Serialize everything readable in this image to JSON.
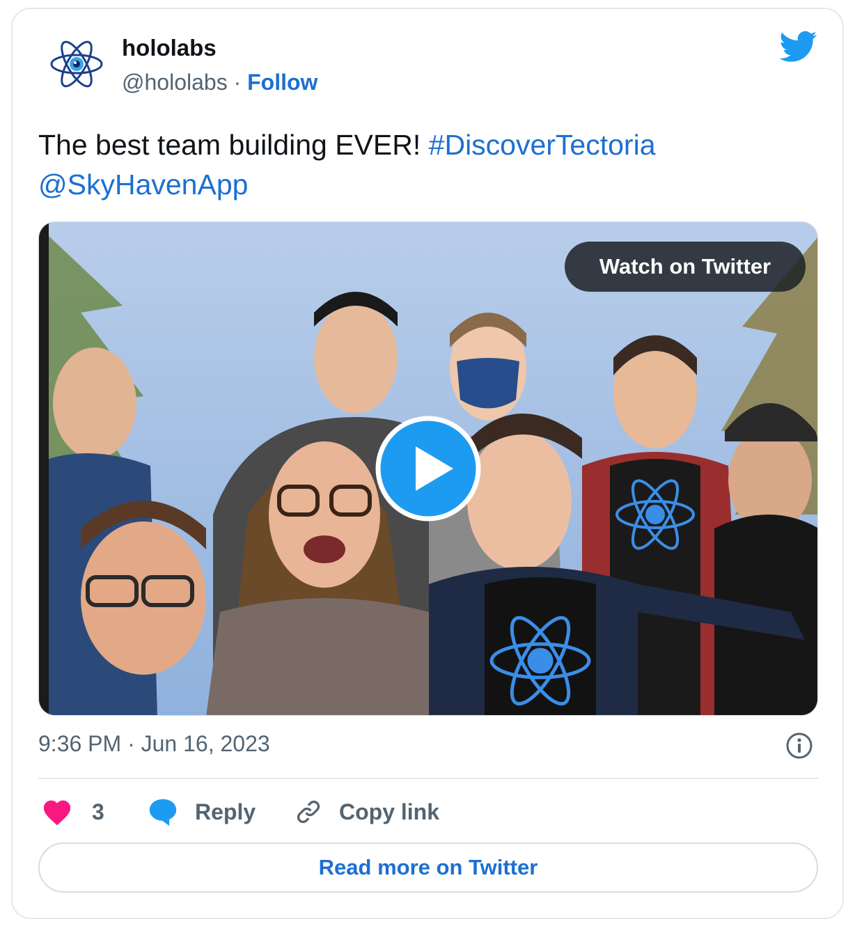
{
  "author": {
    "name": "hololabs",
    "handle": "@hololabs",
    "separator": "·",
    "follow_label": "Follow"
  },
  "tweet": {
    "text": "The best team building EVER!",
    "hashtag": "#DiscoverTectoria",
    "mention": "@SkyHavenApp"
  },
  "media": {
    "watch_label": "Watch on Twitter"
  },
  "meta": {
    "timestamp": "9:36 PM · Jun 16, 2023"
  },
  "actions": {
    "likes_count": "3",
    "reply_label": "Reply",
    "copy_link_label": "Copy link"
  },
  "footer": {
    "read_more_label": "Read more on Twitter"
  },
  "colors": {
    "link": "#1d6fd1",
    "like": "#f91880",
    "twitter_blue": "#1d9bf0",
    "muted": "#536471"
  },
  "icons": [
    "atom-logo-icon",
    "twitter-bird-icon",
    "play-icon",
    "info-icon",
    "heart-icon",
    "reply-bubble-icon",
    "link-icon"
  ]
}
